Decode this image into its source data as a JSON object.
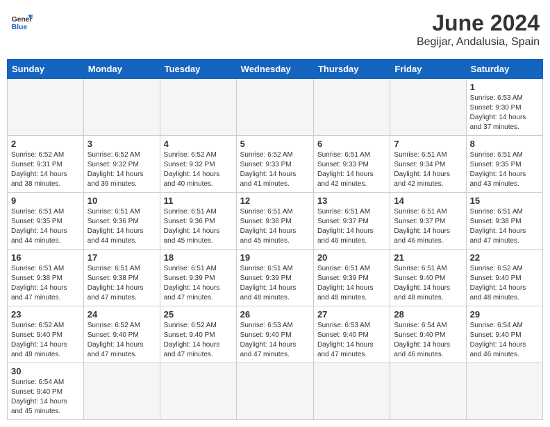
{
  "header": {
    "logo_text_general": "General",
    "logo_text_blue": "Blue",
    "month_title": "June 2024",
    "location": "Begijar, Andalusia, Spain"
  },
  "weekdays": [
    "Sunday",
    "Monday",
    "Tuesday",
    "Wednesday",
    "Thursday",
    "Friday",
    "Saturday"
  ],
  "weeks": [
    [
      {
        "day": "",
        "info": ""
      },
      {
        "day": "",
        "info": ""
      },
      {
        "day": "",
        "info": ""
      },
      {
        "day": "",
        "info": ""
      },
      {
        "day": "",
        "info": ""
      },
      {
        "day": "",
        "info": ""
      },
      {
        "day": "1",
        "info": "Sunrise: 6:53 AM\nSunset: 9:30 PM\nDaylight: 14 hours\nand 37 minutes."
      }
    ],
    [
      {
        "day": "2",
        "info": "Sunrise: 6:52 AM\nSunset: 9:31 PM\nDaylight: 14 hours\nand 38 minutes."
      },
      {
        "day": "3",
        "info": "Sunrise: 6:52 AM\nSunset: 9:32 PM\nDaylight: 14 hours\nand 39 minutes."
      },
      {
        "day": "4",
        "info": "Sunrise: 6:52 AM\nSunset: 9:32 PM\nDaylight: 14 hours\nand 40 minutes."
      },
      {
        "day": "5",
        "info": "Sunrise: 6:52 AM\nSunset: 9:33 PM\nDaylight: 14 hours\nand 41 minutes."
      },
      {
        "day": "6",
        "info": "Sunrise: 6:51 AM\nSunset: 9:33 PM\nDaylight: 14 hours\nand 42 minutes."
      },
      {
        "day": "7",
        "info": "Sunrise: 6:51 AM\nSunset: 9:34 PM\nDaylight: 14 hours\nand 42 minutes."
      },
      {
        "day": "8",
        "info": "Sunrise: 6:51 AM\nSunset: 9:35 PM\nDaylight: 14 hours\nand 43 minutes."
      }
    ],
    [
      {
        "day": "9",
        "info": "Sunrise: 6:51 AM\nSunset: 9:35 PM\nDaylight: 14 hours\nand 44 minutes."
      },
      {
        "day": "10",
        "info": "Sunrise: 6:51 AM\nSunset: 9:36 PM\nDaylight: 14 hours\nand 44 minutes."
      },
      {
        "day": "11",
        "info": "Sunrise: 6:51 AM\nSunset: 9:36 PM\nDaylight: 14 hours\nand 45 minutes."
      },
      {
        "day": "12",
        "info": "Sunrise: 6:51 AM\nSunset: 9:36 PM\nDaylight: 14 hours\nand 45 minutes."
      },
      {
        "day": "13",
        "info": "Sunrise: 6:51 AM\nSunset: 9:37 PM\nDaylight: 14 hours\nand 46 minutes."
      },
      {
        "day": "14",
        "info": "Sunrise: 6:51 AM\nSunset: 9:37 PM\nDaylight: 14 hours\nand 46 minutes."
      },
      {
        "day": "15",
        "info": "Sunrise: 6:51 AM\nSunset: 9:38 PM\nDaylight: 14 hours\nand 47 minutes."
      }
    ],
    [
      {
        "day": "16",
        "info": "Sunrise: 6:51 AM\nSunset: 9:38 PM\nDaylight: 14 hours\nand 47 minutes."
      },
      {
        "day": "17",
        "info": "Sunrise: 6:51 AM\nSunset: 9:38 PM\nDaylight: 14 hours\nand 47 minutes."
      },
      {
        "day": "18",
        "info": "Sunrise: 6:51 AM\nSunset: 9:39 PM\nDaylight: 14 hours\nand 47 minutes."
      },
      {
        "day": "19",
        "info": "Sunrise: 6:51 AM\nSunset: 9:39 PM\nDaylight: 14 hours\nand 48 minutes."
      },
      {
        "day": "20",
        "info": "Sunrise: 6:51 AM\nSunset: 9:39 PM\nDaylight: 14 hours\nand 48 minutes."
      },
      {
        "day": "21",
        "info": "Sunrise: 6:51 AM\nSunset: 9:40 PM\nDaylight: 14 hours\nand 48 minutes."
      },
      {
        "day": "22",
        "info": "Sunrise: 6:52 AM\nSunset: 9:40 PM\nDaylight: 14 hours\nand 48 minutes."
      }
    ],
    [
      {
        "day": "23",
        "info": "Sunrise: 6:52 AM\nSunset: 9:40 PM\nDaylight: 14 hours\nand 48 minutes."
      },
      {
        "day": "24",
        "info": "Sunrise: 6:52 AM\nSunset: 9:40 PM\nDaylight: 14 hours\nand 47 minutes."
      },
      {
        "day": "25",
        "info": "Sunrise: 6:52 AM\nSunset: 9:40 PM\nDaylight: 14 hours\nand 47 minutes."
      },
      {
        "day": "26",
        "info": "Sunrise: 6:53 AM\nSunset: 9:40 PM\nDaylight: 14 hours\nand 47 minutes."
      },
      {
        "day": "27",
        "info": "Sunrise: 6:53 AM\nSunset: 9:40 PM\nDaylight: 14 hours\nand 47 minutes."
      },
      {
        "day": "28",
        "info": "Sunrise: 6:54 AM\nSunset: 9:40 PM\nDaylight: 14 hours\nand 46 minutes."
      },
      {
        "day": "29",
        "info": "Sunrise: 6:54 AM\nSunset: 9:40 PM\nDaylight: 14 hours\nand 46 minutes."
      }
    ],
    [
      {
        "day": "30",
        "info": "Sunrise: 6:54 AM\nSunset: 9:40 PM\nDaylight: 14 hours\nand 45 minutes."
      },
      {
        "day": "",
        "info": ""
      },
      {
        "day": "",
        "info": ""
      },
      {
        "day": "",
        "info": ""
      },
      {
        "day": "",
        "info": ""
      },
      {
        "day": "",
        "info": ""
      },
      {
        "day": "",
        "info": ""
      }
    ]
  ]
}
